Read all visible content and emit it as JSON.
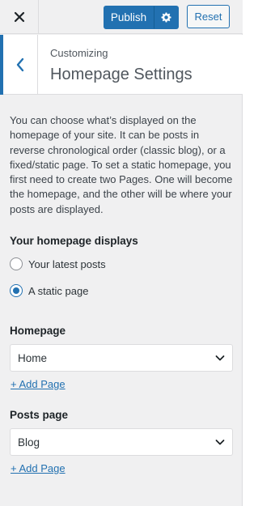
{
  "header": {
    "close_icon": "close-icon",
    "publish_label": "Publish",
    "publish_settings_icon": "gear-icon",
    "reset_label": "Reset"
  },
  "section": {
    "back_icon": "chevron-left-icon",
    "breadcrumb": "Customizing",
    "title": "Homepage Settings"
  },
  "description": "You can choose what’s displayed on the homepage of your site. It can be posts in reverse chronological order (classic blog), or a fixed/static page. To set a static homepage, you first need to create two Pages. One will become the homepage, and the other will be where your posts are displayed.",
  "homepage_displays": {
    "label": "Your homepage displays",
    "options": [
      {
        "label": "Your latest posts",
        "checked": false
      },
      {
        "label": "A static page",
        "checked": true
      }
    ]
  },
  "homepage": {
    "label": "Homepage",
    "selected": "Home",
    "add_link": "+ Add Page"
  },
  "posts_page": {
    "label": "Posts page",
    "selected": "Blog",
    "add_link": "+ Add Page"
  },
  "colors": {
    "accent": "#2271b1",
    "panel_bg": "#f0f0f1"
  }
}
